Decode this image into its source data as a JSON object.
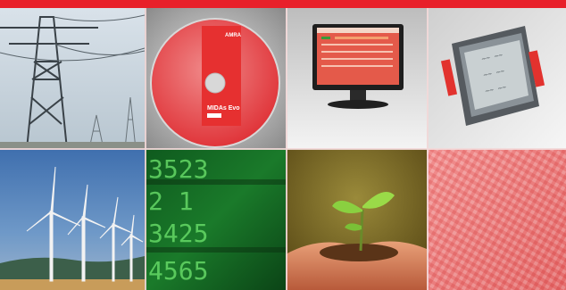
{
  "brand": {
    "accent": "#e8202a"
  },
  "tiles": [
    {
      "name": "power-transmission-tower-tile",
      "icon": "pylon-icon"
    },
    {
      "name": "software-cd-tile",
      "icon": "cd-icon",
      "cd_logo": "AMRA",
      "cd_title": "MIDAs Evo"
    },
    {
      "name": "monitor-display-tile",
      "icon": "monitor-icon"
    },
    {
      "name": "energy-meter-device-tile",
      "icon": "meter-icon"
    },
    {
      "name": "wind-turbines-tile",
      "icon": "wind-turbine-icon"
    },
    {
      "name": "green-digits-tile",
      "icon": "digits-icon",
      "digits": [
        "3523",
        "2 1",
        "3425",
        "4565"
      ]
    },
    {
      "name": "seedling-in-hands-tile",
      "icon": "seedling-icon"
    },
    {
      "name": "red-texture-tile",
      "icon": "texture-icon"
    }
  ]
}
